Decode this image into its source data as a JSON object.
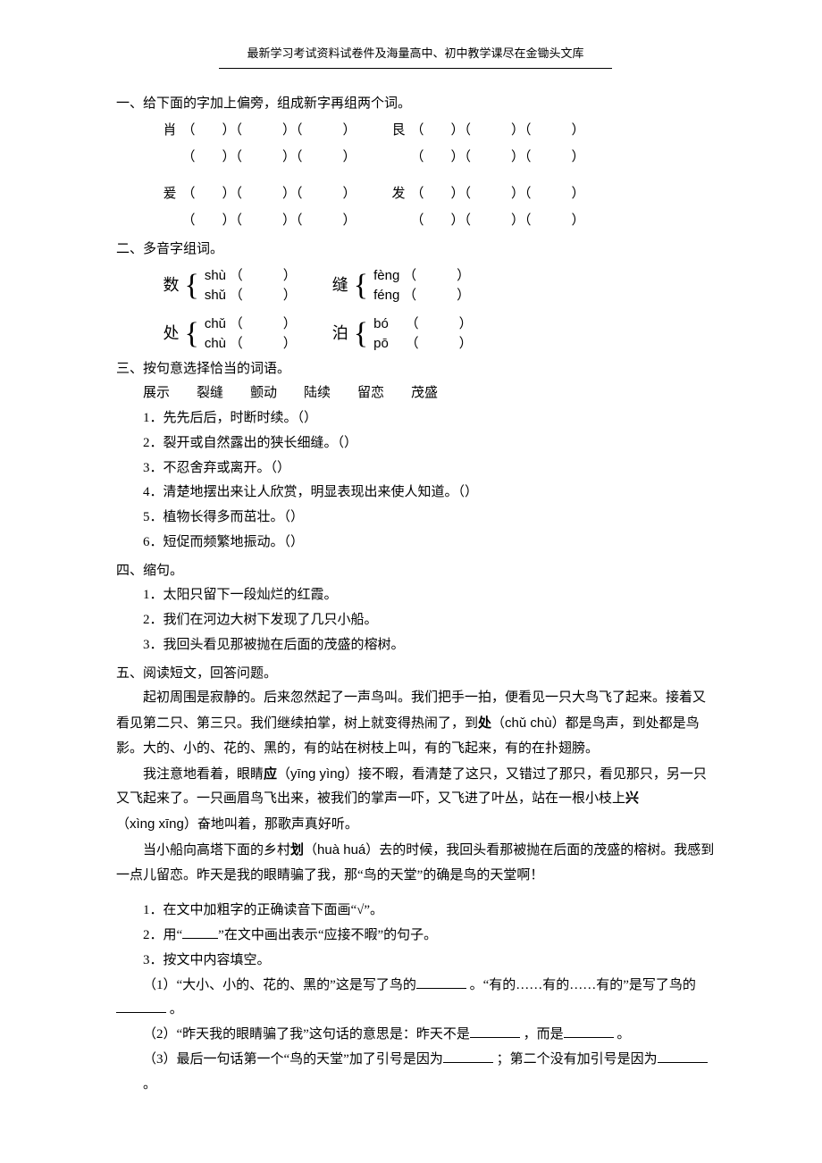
{
  "header": "最新学习考试资料试卷件及海量高中、初中教学课尽在金锄头文库",
  "sections": {
    "s1": {
      "title": "一、给下面的字加上偏旁，组成新字再组两个词。",
      "row1a_lead": "肖",
      "row1b_lead": "艮",
      "row2a_lead": "爰",
      "row2b_lead": "发",
      "paren_group": "（　　）（　　　）（　　　）",
      "paren_group_noLead": "（　　）（　　　）（　　　）"
    },
    "s2": {
      "title": "二、多音字组词。",
      "pairs": [
        {
          "char": "数",
          "read1": "shù",
          "read2": "shǔ"
        },
        {
          "char": "缝",
          "read1": "fèng",
          "read2": "féng"
        },
        {
          "char": "处",
          "read1": "chǔ",
          "read2": "chù"
        },
        {
          "char": "泊",
          "read1": "bó",
          "read2": "pō"
        }
      ],
      "paren": "（　　　）"
    },
    "s3": {
      "title": "三、按句意选择恰当的词语。",
      "words": "展示　　裂缝　　颤动　　陆续　　留恋　　茂盛",
      "items": [
        "1．先先后后，时断时续。（）",
        "2．裂开或自然露出的狭长细缝。（）",
        "3．不忍舍弃或离开。（）",
        "4．清楚地摆出来让人欣赏，明显表现出来使人知道。（）",
        "5．植物长得多而茁壮。（）",
        "6．短促而频繁地振动。（）"
      ]
    },
    "s4": {
      "title": "四、缩句。",
      "items": [
        "1．太阳只留下一段灿烂的红霞。",
        "2．我们在河边大树下发现了几只小船。",
        "3．我回头看见那被抛在后面的茂盛的榕树。"
      ]
    },
    "s5": {
      "title": "五、阅读短文，回答问题。",
      "p1_a": "起初周围是寂静的。后来忽然起了一声鸟叫。我们把手一拍，便看见一只大鸟飞了起来。接着又看见第二只、第三只。我们继续拍掌，树上就变得热闹了，到",
      "p1_chu": "处",
      "p1_chu_py": "（chǔ chù）",
      "p1_b": "都是鸟声，到处都是鸟影。大的、小的、花的、黑的，有的站在树枝上叫，有的飞起来，有的在扑翅膀。",
      "p2_a": "我注意地看着，眼睛",
      "p2_ying": "应",
      "p2_ying_py": "（yīng yìng）",
      "p2_b": "接不暇，看清楚了这只，又错过了那只，看见那只，另一只又飞起来了。一只画眉鸟飞出来，被我们的掌声一吓，又飞进了叶丛，站在一根小枝上",
      "p2_xing": "兴",
      "p2_xing_py": "（xìng xīng）",
      "p2_c": "奋地叫着，那歌声真好听。",
      "p3_a": "当小船向高塔下面的乡村",
      "p3_hua": "划",
      "p3_hua_py": "（huà huá）",
      "p3_b": "去的时候，我回头看那被抛在后面的茂盛的榕树。我感到一点儿留恋。昨天是我的眼睛骗了我，那“鸟的天堂”的确是鸟的天堂啊！",
      "q1": "1．在文中加粗字的正确读音下面画“√”。",
      "q2_a": "2．用“",
      "q2_b": "”在文中画出表示“应接不暇”的句子。",
      "q3": "3．按文中内容填空。",
      "q3_1_a": "（1）“大小、小的、花的、黑的”这是写了鸟的",
      "q3_1_b": " 。“有的……有的……有的”是写了鸟的",
      "q3_1_c": " 。",
      "q3_2_a": "（2）“昨天我的眼睛骗了我”这句话的意思是：昨天不是",
      "q3_2_b": " ，而是",
      "q3_2_c": " 。",
      "q3_3_a": "（3）最后一句话第一个“鸟的天堂”加了引号是因为",
      "q3_3_b": " ；第二个没有加引号是因为",
      "q3_3_c": " 。"
    }
  }
}
